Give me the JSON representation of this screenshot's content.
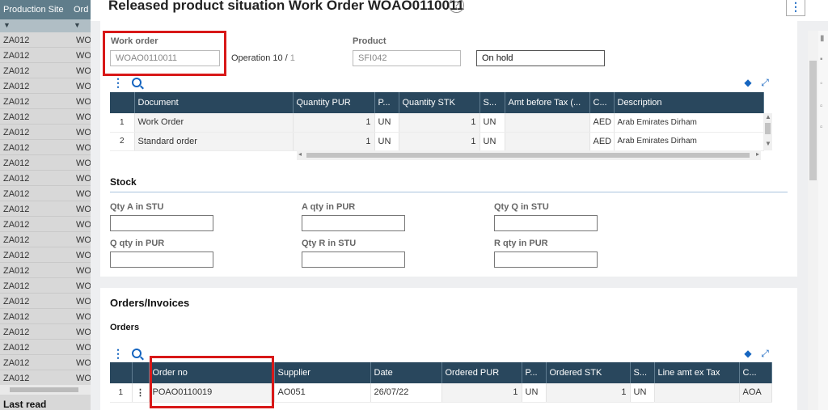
{
  "background_grid": {
    "col1_header": "Production Site",
    "col2_header": "Ord",
    "filter_icon_1": "filter-icon",
    "filter_icon_2": "filter-icon",
    "rows": [
      {
        "site": "ZA012",
        "ord": "WO"
      },
      {
        "site": "ZA012",
        "ord": "WO"
      },
      {
        "site": "ZA012",
        "ord": "WO"
      },
      {
        "site": "ZA012",
        "ord": "WO"
      },
      {
        "site": "ZA012",
        "ord": "WO"
      },
      {
        "site": "ZA012",
        "ord": "WO"
      },
      {
        "site": "ZA012",
        "ord": "WO"
      },
      {
        "site": "ZA012",
        "ord": "WO"
      },
      {
        "site": "ZA012",
        "ord": "WO"
      },
      {
        "site": "ZA012",
        "ord": "WO"
      },
      {
        "site": "ZA012",
        "ord": "WO"
      },
      {
        "site": "ZA012",
        "ord": "WO"
      },
      {
        "site": "ZA012",
        "ord": "WO"
      },
      {
        "site": "ZA012",
        "ord": "WO"
      },
      {
        "site": "ZA012",
        "ord": "WO"
      },
      {
        "site": "ZA012",
        "ord": "WO"
      },
      {
        "site": "ZA012",
        "ord": "WO"
      },
      {
        "site": "ZA012",
        "ord": "WO"
      },
      {
        "site": "ZA012",
        "ord": "WO"
      },
      {
        "site": "ZA012",
        "ord": "WO"
      },
      {
        "site": "ZA012",
        "ord": "WO"
      },
      {
        "site": "ZA012",
        "ord": "WO"
      },
      {
        "site": "ZA012",
        "ord": "WO"
      }
    ],
    "footer": "Last read"
  },
  "dialog": {
    "title": "Released product situation Work Order WOAO0110011",
    "help_glyph": "?",
    "menu_glyph": "⋮"
  },
  "header": {
    "work_order_label": "Work order",
    "work_order_value": "WOAO0110011",
    "operation_prefix": "Operation 10 /",
    "operation_total": "1",
    "product_label": "Product",
    "product_value": "SFI042",
    "status_value": "On hold"
  },
  "documents_grid": {
    "columns": [
      "Document",
      "Quantity PUR",
      "P...",
      "Quantity STK",
      "S...",
      "Amt before Tax (...",
      "C...",
      "Description"
    ],
    "rows": [
      {
        "n": "1",
        "document": "Work Order",
        "qty_pur": "1",
        "p": "UN",
        "qty_stk": "1",
        "s": "UN",
        "amt": "",
        "c": "AED",
        "desc": "Arab Emirates Dirham"
      },
      {
        "n": "2",
        "document": "Standard order",
        "qty_pur": "1",
        "p": "UN",
        "qty_stk": "1",
        "s": "UN",
        "amt": "",
        "c": "AED",
        "desc": "Arab Emirates Dirham"
      }
    ]
  },
  "stock": {
    "section_title": "Stock",
    "fields": [
      {
        "label": "Qty A in STU",
        "value": ""
      },
      {
        "label": "A qty in PUR",
        "value": ""
      },
      {
        "label": "Qty Q in STU",
        "value": ""
      },
      {
        "label": "Q qty in PUR",
        "value": ""
      },
      {
        "label": "Qty R in STU",
        "value": ""
      },
      {
        "label": "R qty in PUR",
        "value": ""
      }
    ]
  },
  "orders_invoices": {
    "section_title": "Orders/Invoices",
    "sub_title": "Orders",
    "columns": [
      "Order no",
      "Supplier",
      "Date",
      "Ordered PUR",
      "P...",
      "Ordered STK",
      "S...",
      "Line amt ex Tax",
      "C..."
    ],
    "rows": [
      {
        "n": "1",
        "order_no": "POAO0110019",
        "supplier": "AO051",
        "date": "26/07/22",
        "ordered_pur": "1",
        "p": "UN",
        "ordered_stk": "1",
        "s": "UN",
        "line_amt": "",
        "c": "AOA"
      }
    ]
  },
  "colors": {
    "grid_header": "#29475d",
    "accent": "#1565c0",
    "highlight_box": "#d81818",
    "background_header": "#607d8b"
  },
  "icons": [
    "filter-icon",
    "help-icon",
    "more-vert-icon",
    "search-icon",
    "layers-icon",
    "expand-icon",
    "row-menu-icon"
  ]
}
